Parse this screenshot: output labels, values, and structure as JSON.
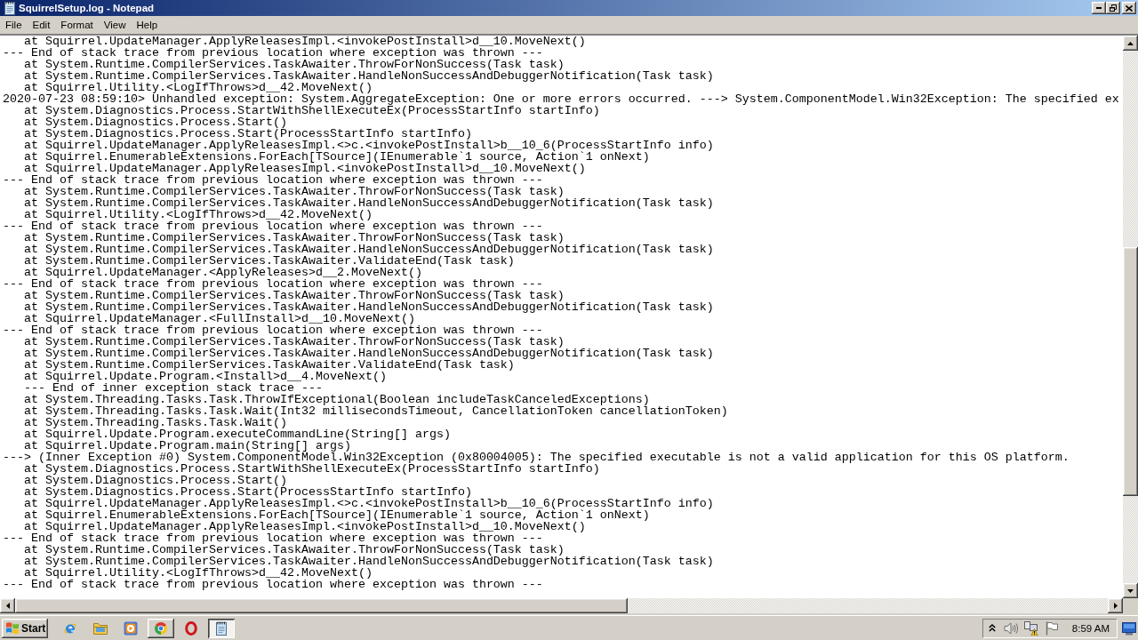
{
  "window": {
    "title": "SquirrelSetup.log - Notepad"
  },
  "menu": [
    "File",
    "Edit",
    "Format",
    "View",
    "Help"
  ],
  "editor": {
    "lines": [
      "   at Squirrel.UpdateManager.ApplyReleasesImpl.<invokePostInstall>d__10.MoveNext()",
      "--- End of stack trace from previous location where exception was thrown ---",
      "   at System.Runtime.CompilerServices.TaskAwaiter.ThrowForNonSuccess(Task task)",
      "   at System.Runtime.CompilerServices.TaskAwaiter.HandleNonSuccessAndDebuggerNotification(Task task)",
      "   at Squirrel.Utility.<LogIfThrows>d__42.MoveNext()",
      "2020-07-23 08:59:10> Unhandled exception: System.AggregateException: One or more errors occurred. ---> System.ComponentModel.Win32Exception: The specified ex",
      "   at System.Diagnostics.Process.StartWithShellExecuteEx(ProcessStartInfo startInfo)",
      "   at System.Diagnostics.Process.Start()",
      "   at System.Diagnostics.Process.Start(ProcessStartInfo startInfo)",
      "   at Squirrel.UpdateManager.ApplyReleasesImpl.<>c.<invokePostInstall>b__10_6(ProcessStartInfo info)",
      "   at Squirrel.EnumerableExtensions.ForEach[TSource](IEnumerable`1 source, Action`1 onNext)",
      "   at Squirrel.UpdateManager.ApplyReleasesImpl.<invokePostInstall>d__10.MoveNext()",
      "--- End of stack trace from previous location where exception was thrown ---",
      "   at System.Runtime.CompilerServices.TaskAwaiter.ThrowForNonSuccess(Task task)",
      "   at System.Runtime.CompilerServices.TaskAwaiter.HandleNonSuccessAndDebuggerNotification(Task task)",
      "   at Squirrel.Utility.<LogIfThrows>d__42.MoveNext()",
      "--- End of stack trace from previous location where exception was thrown ---",
      "   at System.Runtime.CompilerServices.TaskAwaiter.ThrowForNonSuccess(Task task)",
      "   at System.Runtime.CompilerServices.TaskAwaiter.HandleNonSuccessAndDebuggerNotification(Task task)",
      "   at System.Runtime.CompilerServices.TaskAwaiter.ValidateEnd(Task task)",
      "   at Squirrel.UpdateManager.<ApplyReleases>d__2.MoveNext()",
      "--- End of stack trace from previous location where exception was thrown ---",
      "   at System.Runtime.CompilerServices.TaskAwaiter.ThrowForNonSuccess(Task task)",
      "   at System.Runtime.CompilerServices.TaskAwaiter.HandleNonSuccessAndDebuggerNotification(Task task)",
      "   at Squirrel.UpdateManager.<FullInstall>d__10.MoveNext()",
      "--- End of stack trace from previous location where exception was thrown ---",
      "   at System.Runtime.CompilerServices.TaskAwaiter.ThrowForNonSuccess(Task task)",
      "   at System.Runtime.CompilerServices.TaskAwaiter.HandleNonSuccessAndDebuggerNotification(Task task)",
      "   at System.Runtime.CompilerServices.TaskAwaiter.ValidateEnd(Task task)",
      "   at Squirrel.Update.Program.<Install>d__4.MoveNext()",
      "   --- End of inner exception stack trace ---",
      "   at System.Threading.Tasks.Task.ThrowIfExceptional(Boolean includeTaskCanceledExceptions)",
      "   at System.Threading.Tasks.Task.Wait(Int32 millisecondsTimeout, CancellationToken cancellationToken)",
      "   at System.Threading.Tasks.Task.Wait()",
      "   at Squirrel.Update.Program.executeCommandLine(String[] args)",
      "   at Squirrel.Update.Program.main(String[] args)",
      "---> (Inner Exception #0) System.ComponentModel.Win32Exception (0x80004005): The specified executable is not a valid application for this OS platform.",
      "   at System.Diagnostics.Process.StartWithShellExecuteEx(ProcessStartInfo startInfo)",
      "   at System.Diagnostics.Process.Start()",
      "   at System.Diagnostics.Process.Start(ProcessStartInfo startInfo)",
      "   at Squirrel.UpdateManager.ApplyReleasesImpl.<>c.<invokePostInstall>b__10_6(ProcessStartInfo info)",
      "   at Squirrel.EnumerableExtensions.ForEach[TSource](IEnumerable`1 source, Action`1 onNext)",
      "   at Squirrel.UpdateManager.ApplyReleasesImpl.<invokePostInstall>d__10.MoveNext()",
      "--- End of stack trace from previous location where exception was thrown ---",
      "   at System.Runtime.CompilerServices.TaskAwaiter.ThrowForNonSuccess(Task task)",
      "   at System.Runtime.CompilerServices.TaskAwaiter.HandleNonSuccessAndDebuggerNotification(Task task)",
      "   at Squirrel.Utility.<LogIfThrows>d__42.MoveNext()",
      "--- End of stack trace from previous location where exception was thrown ---"
    ]
  },
  "taskbar": {
    "start": "Start",
    "items": [
      {
        "kind": "launcher",
        "selected": false
      },
      {
        "kind": "launcher",
        "selected": false
      },
      {
        "kind": "launcher",
        "selected": false
      },
      {
        "kind": "window",
        "selected": false
      },
      {
        "kind": "launcher",
        "selected": false
      },
      {
        "kind": "window",
        "selected": true
      }
    ],
    "clock": "8:59 AM"
  }
}
